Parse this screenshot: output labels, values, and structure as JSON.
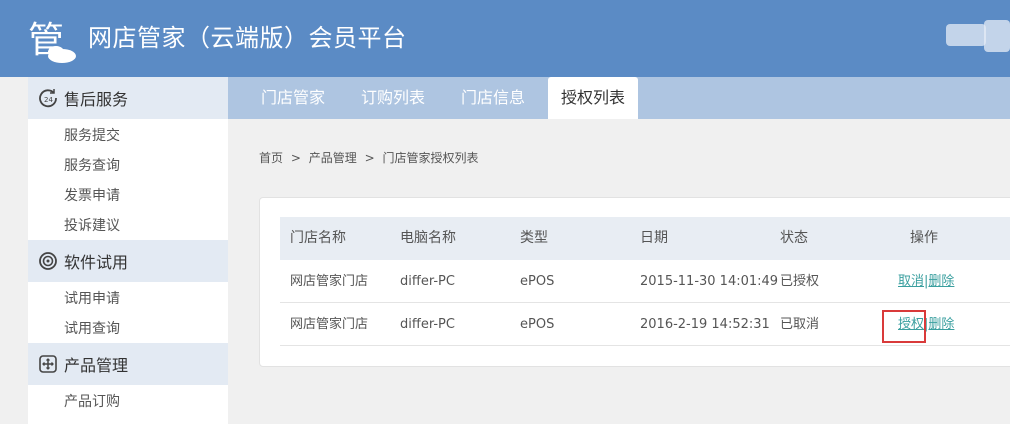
{
  "header": {
    "title": "网店管家（云端版）会员平台",
    "logo_glyph": "管"
  },
  "sidebar": {
    "sections": [
      {
        "label": "售后服务",
        "icon": "24h-clock-icon",
        "items": [
          "服务提交",
          "服务查询",
          "发票申请",
          "投诉建议"
        ]
      },
      {
        "label": "软件试用",
        "icon": "disc-icon",
        "items": [
          "试用申请",
          "试用查询"
        ]
      },
      {
        "label": "产品管理",
        "icon": "move-icon",
        "items": [
          "产品订购"
        ]
      }
    ]
  },
  "tabs": [
    "门店管家",
    "订购列表",
    "门店信息",
    "授权列表"
  ],
  "active_tab": "授权列表",
  "breadcrumb": [
    "首页",
    ">",
    "产品管理",
    ">",
    "门店管家授权列表"
  ],
  "table": {
    "columns": [
      "门店名称",
      "电脑名称",
      "类型",
      "日期",
      "状态",
      "操作"
    ],
    "rows": [
      {
        "store": "网店管家门店",
        "pc": "differ-PC",
        "type": "ePOS",
        "date": "2015-11-30 14:01:49",
        "status": "已授权",
        "action1": "取消",
        "action2": "删除"
      },
      {
        "store": "网店管家门店",
        "pc": "differ-PC",
        "type": "ePOS",
        "date": "2016-2-19 14:52:31",
        "status": "已取消",
        "action1": "授权",
        "action2": "删除"
      }
    ]
  },
  "colors": {
    "header_bg": "#5b8bc5",
    "tab_bar": "#aec5e1",
    "link": "#3a9f9f",
    "highlight": "#d93a3a"
  }
}
